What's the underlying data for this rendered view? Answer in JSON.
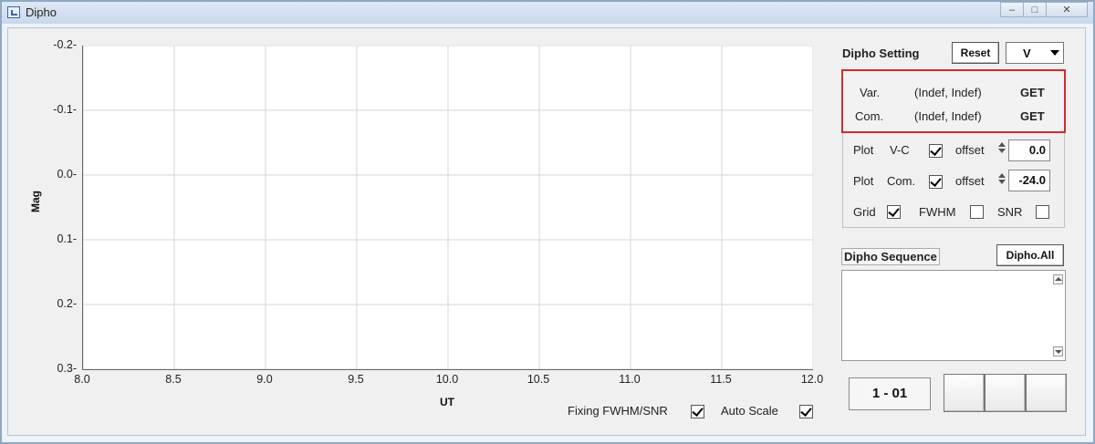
{
  "window": {
    "title": "Dipho",
    "minimize_icon": "minimize-icon",
    "maximize_icon": "maximize-icon",
    "close_icon": "close-icon"
  },
  "chart_data": {
    "type": "line",
    "xlabel": "UT",
    "ylabel": "Mag",
    "xlim": [
      8.0,
      12.0
    ],
    "ylim": [
      0.3,
      -0.2
    ],
    "y_inverted": true,
    "x_ticks": [
      "8.0",
      "8.5",
      "9.0",
      "9.5",
      "10.0",
      "10.5",
      "11.0",
      "11.5",
      "12.0"
    ],
    "y_ticks": [
      "-0.2",
      "-0.1",
      "0.0",
      "0.1",
      "0.2",
      "0.3"
    ],
    "grid": true,
    "series": []
  },
  "bottom_options": {
    "fixing_label": "Fixing FWHM/SNR",
    "fixing_checked": true,
    "autoscale_label": "Auto Scale",
    "autoscale_checked": true
  },
  "setting": {
    "title": "Dipho Setting",
    "reset_label": "Reset",
    "filter_value": "V",
    "var_label": "Var.",
    "var_value": "(Indef, Indef)",
    "var_get": "GET",
    "com_label": "Com.",
    "com_value": "(Indef, Indef)",
    "com_get": "GET",
    "plot_label": "Plot",
    "vc_label": "V-C",
    "vc_checked": true,
    "offset_label": "offset",
    "vc_offset": "0.0",
    "com_plot_label": "Com.",
    "com_checked": true,
    "com_offset": "-24.0",
    "grid_label": "Grid",
    "grid_checked": true,
    "fwhm_label": "FWHM",
    "fwhm_checked": false,
    "snr_label": "SNR",
    "snr_checked": false
  },
  "sequence": {
    "title": "Dipho Sequence",
    "all_label": "Dipho.All",
    "text": ""
  },
  "counter": "1 - 01"
}
